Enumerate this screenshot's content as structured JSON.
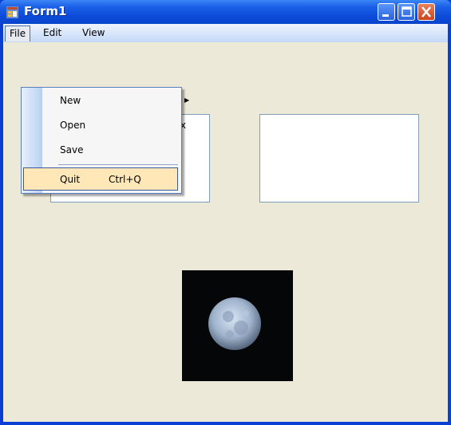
{
  "window": {
    "title": "Form1",
    "icon": "form-app-icon",
    "controls": [
      "minimize-icon",
      "maximize-icon",
      "close-icon"
    ]
  },
  "menubar": {
    "items": [
      {
        "label": "File",
        "active": true
      },
      {
        "label": "Edit"
      },
      {
        "label": "View"
      }
    ]
  },
  "file_menu": {
    "items": [
      {
        "label": "New",
        "submenu": true
      },
      {
        "label": "Open"
      },
      {
        "label": "Save"
      },
      {
        "label": "Quit",
        "shortcut": "Ctrl+Q",
        "highlighted": true
      }
    ]
  },
  "textbox1": {
    "visible_text": "x"
  },
  "textbox2": {
    "visible_text": ""
  },
  "picture": {
    "subject": "moon"
  },
  "colors": {
    "title_bar": "#0b4ad8",
    "client": "#ece9d8",
    "highlight": "#ffe7b8",
    "close_button": "#c9431e"
  }
}
